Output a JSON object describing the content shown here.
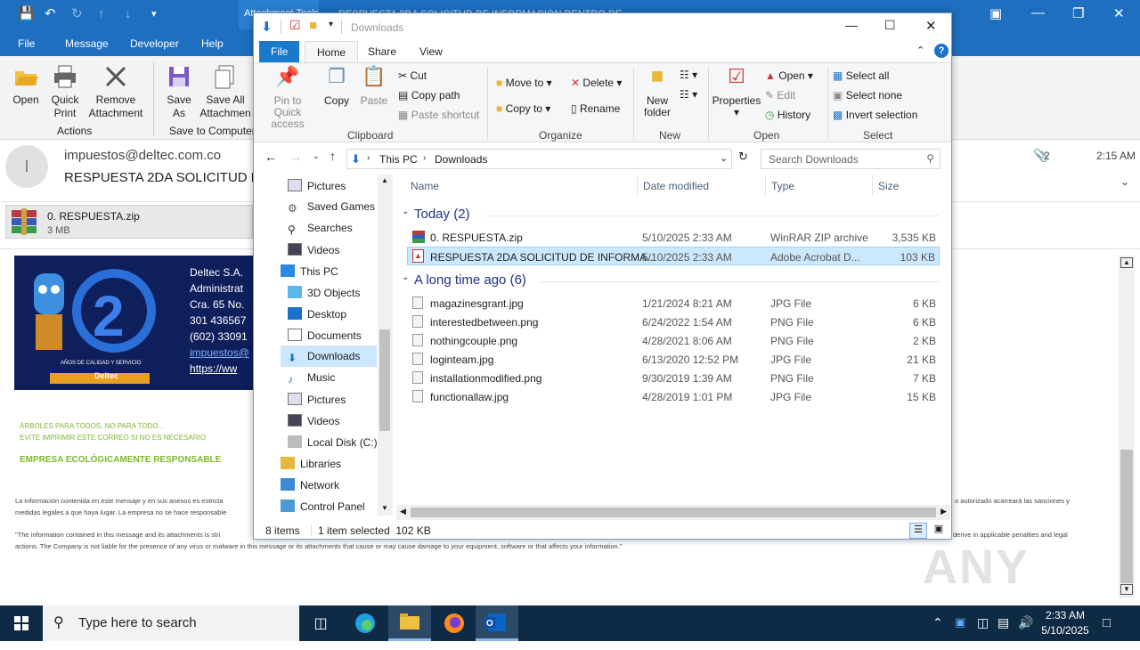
{
  "outlook": {
    "context_tab": "Attachment Tools",
    "title_text": "RESPUESTA 2DA SOLICITUD DE INFORMACIÓN DENTRO DE ...",
    "menu": [
      "File",
      "Message",
      "Developer",
      "Help"
    ],
    "ribbon": {
      "open": "Open",
      "quick_print_1": "Quick",
      "quick_print_2": "Print",
      "remove_1": "Remove",
      "remove_2": "Attachment",
      "actions_group": "Actions",
      "save_as_1": "Save",
      "save_as_2": "As",
      "save_all_1": "Save All",
      "save_all_2": "Attachmen",
      "save_group": "Save to Computer"
    },
    "avatar_initial": "I",
    "sender": "impuestos@deltec.com.co",
    "subject": "RESPUESTA 2DA SOLICITUD DE",
    "attachment_count": "2",
    "time": "2:15 AM",
    "attachment": {
      "name": "0. RESPUESTA.zip",
      "size": "3 MB"
    },
    "signature": {
      "lines": [
        "Deltec S.A.",
        "Administrat",
        "Cra. 65 No.",
        "301 436567",
        "(602) 33091"
      ],
      "email": "impuestos@",
      "web": "https://ww"
    },
    "logo": {
      "years": "AÑOS DE CALIDAD Y SERVICIO",
      "brand": "Deltec"
    },
    "green_1": "ÁRBOLES PARA TODOS, NO PARA TODO...",
    "green_2": "EVITE IMPRIMIR ESTE CORREO SI NO ES NECESARIO",
    "green_3": "EMPRESA ECOLÓGICAMENTE RESPONSABLE",
    "disclaimer_1a": "La información contenida en este mensaje y en sus anexos es estricta",
    "disclaimer_1b": "medidas legales a que haya lugar.  La empresa no se hace responsable",
    "disclaimer_1c": "o autorizado acarreará las sanciones y",
    "disclaimer_2a": "\"The information contained in this message and its attachments is stri",
    "disclaimer_2b": "actions. The Company is not liable for the presence of any virus or malware in this message or its attachments that cause or may cause damage to your equipment, software or that affects your information.\"",
    "disclaimer_2c": "derive in applicable penalties and legal"
  },
  "explorer": {
    "title": "Downloads",
    "tabs": [
      "File",
      "Home",
      "Share",
      "View"
    ],
    "ribbon": {
      "pin_1": "Pin to Quick",
      "pin_2": "access",
      "copy": "Copy",
      "paste": "Paste",
      "cut": "Cut",
      "copy_path": "Copy path",
      "paste_shortcut": "Paste shortcut",
      "clipboard": "Clipboard",
      "move_to": "Move to",
      "copy_to": "Copy to",
      "delete": "Delete",
      "rename": "Rename",
      "organize": "Organize",
      "new_folder_1": "New",
      "new_folder_2": "folder",
      "new": "New",
      "properties": "Properties",
      "open": "Open",
      "edit": "Edit",
      "history": "History",
      "open_group": "Open",
      "select_all": "Select all",
      "select_none": "Select none",
      "invert": "Invert selection",
      "select_group": "Select"
    },
    "breadcrumb": [
      "This PC",
      "Downloads"
    ],
    "search_placeholder": "Search Downloads",
    "nav": [
      "Pictures",
      "Saved Games",
      "Searches",
      "Videos",
      "This PC",
      "3D Objects",
      "Desktop",
      "Documents",
      "Downloads",
      "Music",
      "Pictures",
      "Videos",
      "Local Disk (C:)",
      "Libraries",
      "Network",
      "Control Panel"
    ],
    "columns": [
      "Name",
      "Date modified",
      "Type",
      "Size"
    ],
    "group_today": "Today (2)",
    "group_old": "A long time ago (6)",
    "today_files": [
      {
        "name": "0. RESPUESTA.zip",
        "date": "5/10/2025 2:33 AM",
        "type": "WinRAR ZIP archive",
        "size": "3,535 KB"
      },
      {
        "name": "RESPUESTA 2DA SOLICITUD DE INFORMA...",
        "date": "5/10/2025 2:33 AM",
        "type": "Adobe Acrobat D...",
        "size": "103 KB"
      }
    ],
    "old_files": [
      {
        "name": "magazinesgrant.jpg",
        "date": "1/21/2024 8:21 AM",
        "type": "JPG File",
        "size": "6 KB"
      },
      {
        "name": "interestedbetween.png",
        "date": "6/24/2022 1:54 AM",
        "type": "PNG File",
        "size": "6 KB"
      },
      {
        "name": "nothingcouple.png",
        "date": "4/28/2021 8:06 AM",
        "type": "PNG File",
        "size": "2 KB"
      },
      {
        "name": "loginteam.jpg",
        "date": "6/13/2020 12:52 PM",
        "type": "JPG File",
        "size": "21 KB"
      },
      {
        "name": "installationmodified.png",
        "date": "9/30/2019 1:39 AM",
        "type": "PNG File",
        "size": "7 KB"
      },
      {
        "name": "functionallaw.jpg",
        "date": "4/28/2019 1:01 PM",
        "type": "JPG File",
        "size": "15 KB"
      }
    ],
    "status_items": "8 items",
    "status_selected": "1 item selected  102 KB"
  },
  "taskbar": {
    "search_placeholder": "Type here to search",
    "time": "2:33 AM",
    "date": "5/10/2025"
  },
  "watermark": "ANY RUN"
}
